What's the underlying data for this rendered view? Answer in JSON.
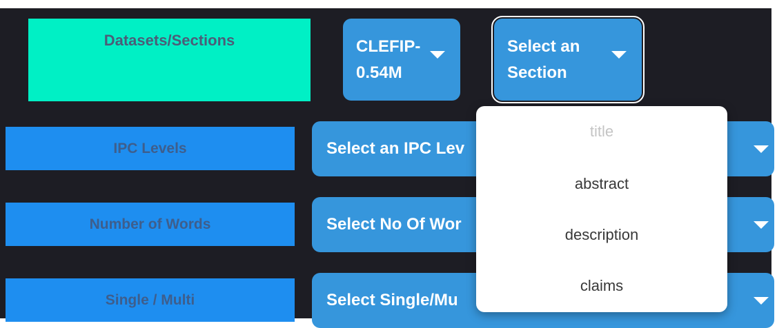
{
  "labels": {
    "datasets_sections": "Datasets/Sections",
    "ipc_levels": "IPC Levels",
    "number_of_words": "Number of Words",
    "single_multi": "Single / Multi"
  },
  "dataset_select": {
    "line1": "CLEFIP-",
    "line2": "0.54M"
  },
  "section_select": {
    "line1": "Select an",
    "line2": "Section",
    "options": [
      "title",
      "abstract",
      "description",
      "claims"
    ]
  },
  "ipc_select": {
    "placeholder": "Select an IPC Lev"
  },
  "words_select": {
    "placeholder": "Select No Of Wor"
  },
  "single_multi_select": {
    "placeholder": "Select Single/Mu"
  },
  "icons": {
    "dropdown_caret": "caret-down-icon"
  },
  "colors": {
    "background": "#1d1d24",
    "datasets_label_bg": "#00f0c5",
    "row_label_bg": "#1e8ef0",
    "select_bg": "#3696dc",
    "dropdown_bg": "#ffffff"
  }
}
